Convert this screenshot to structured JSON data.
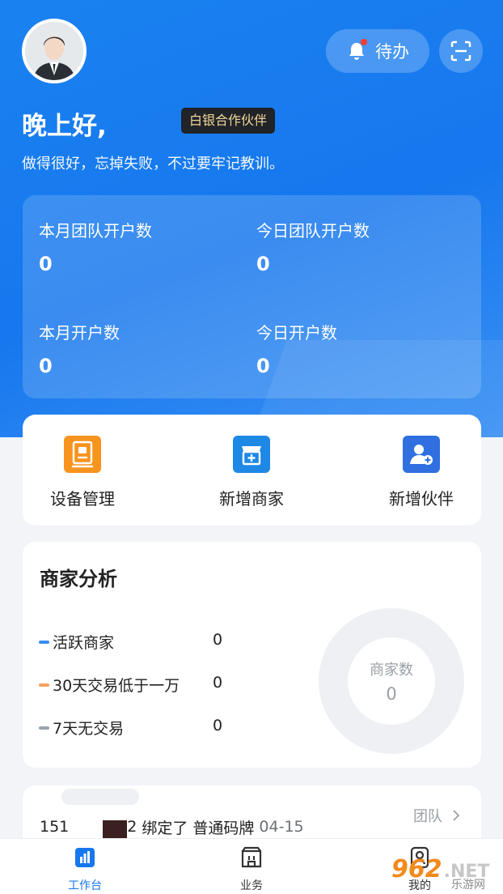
{
  "header": {
    "todo_label": "待办",
    "greeting": "晚上好,",
    "partner_badge": "白银合作伙伴",
    "motto": "做得很好，忘掉失败，不过要牢记教训。"
  },
  "stats": [
    {
      "label": "本月团队开户数",
      "value": "0"
    },
    {
      "label": "今日团队开户数",
      "value": "0"
    },
    {
      "label": "本月开户数",
      "value": "0"
    },
    {
      "label": "今日开户数",
      "value": "0"
    }
  ],
  "quick_actions": [
    {
      "label": "设备管理",
      "icon": "device-icon",
      "color": "#f7941d"
    },
    {
      "label": "新增商家",
      "icon": "store-add-icon",
      "color": "#1e88e5"
    },
    {
      "label": "新增伙伴",
      "icon": "user-add-icon",
      "color": "#2f6fe0"
    }
  ],
  "analysis": {
    "title": "商家分析",
    "rows": [
      {
        "label": "活跃商家",
        "value": "0",
        "color": "#3b8cf0"
      },
      {
        "label": "30天交易低于一万",
        "value": "0",
        "color": "#f5a25d"
      },
      {
        "label": "7天无交易",
        "value": "0",
        "color": "#9aa3ad"
      }
    ],
    "donut_title": "商家数",
    "donut_value": "0"
  },
  "feed": {
    "team_link": "团队",
    "phone_prefix": "151",
    "phone_suffix": "2",
    "action": "绑定了 普通码牌",
    "date": "04-15"
  },
  "tabbar": [
    {
      "label": "工作台",
      "icon": "chart-icon"
    },
    {
      "label": "业务",
      "icon": "business-icon"
    },
    {
      "label": "我的",
      "icon": "profile-icon"
    }
  ],
  "watermark": {
    "brand": "962",
    "suffix": ".NET",
    "site": "乐游网"
  },
  "colors": {
    "primary": "#1677ee",
    "badge_bg": "#202327",
    "badge_text": "#f2d79a"
  }
}
